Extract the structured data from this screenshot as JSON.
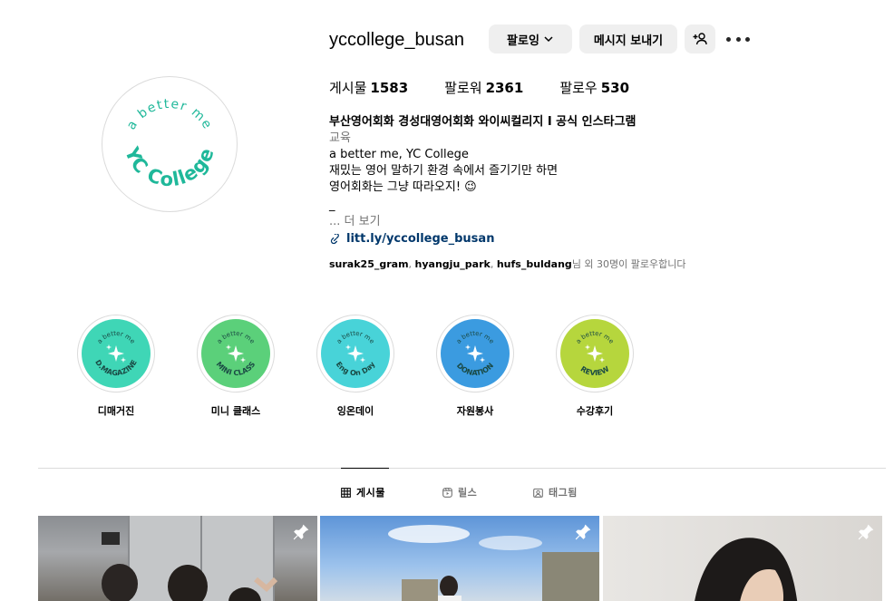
{
  "profile": {
    "username": "yccollege_busan",
    "avatar_text_top": "a better me",
    "avatar_text_bottom": "YC College",
    "buttons": {
      "following": "팔로잉",
      "message": "메시지 보내기"
    },
    "stats": [
      {
        "label": "게시물",
        "value": "1583"
      },
      {
        "label": "팔로워",
        "value": "2361"
      },
      {
        "label": "팔로우",
        "value": "530"
      }
    ],
    "bio": {
      "name": "부산영어회화 경성대영어회화 와이씨컬리지 I 공식 인스타그램",
      "category": "교육",
      "lines": [
        "a better me, YC College",
        "재밌는 영어 말하기 환경 속에서 즐기기만 하면",
        "영어회화는 그냥 따라오지! 😉",
        "_"
      ],
      "more": "... 더 보기",
      "link": "litt.ly/yccollege_busan"
    },
    "followed_by": {
      "users": [
        "surak25_gram",
        "hyangju_park",
        "hufs_buldang"
      ],
      "suffix": "님 외 30명이 팔로우합니다"
    }
  },
  "highlights": [
    {
      "label": "디매거진",
      "badge_top": "a better me",
      "badge_bottom": "D.MAGAZINE",
      "color": "#3fd6b6"
    },
    {
      "label": "미니 클래스",
      "badge_top": "a better me",
      "badge_bottom": "MINI CLASS",
      "color": "#5bd07a"
    },
    {
      "label": "잉온데이",
      "badge_top": "a better me",
      "badge_bottom": "Eng On Day",
      "color": "#48d3d8"
    },
    {
      "label": "자원봉사",
      "badge_top": "a better me",
      "badge_bottom": "DONATION",
      "color": "#3b9be0"
    },
    {
      "label": "수강후기",
      "badge_top": "a better me",
      "badge_bottom": "REVIEW",
      "color": "#b6d63d"
    }
  ],
  "tabs": [
    {
      "label": "게시물",
      "active": true
    },
    {
      "label": "릴스",
      "active": false
    },
    {
      "label": "태그됨",
      "active": false
    }
  ],
  "colors": {
    "brand_teal": "#1fb89a",
    "link": "#00376b",
    "muted": "#737373",
    "button_bg": "#efefef"
  }
}
